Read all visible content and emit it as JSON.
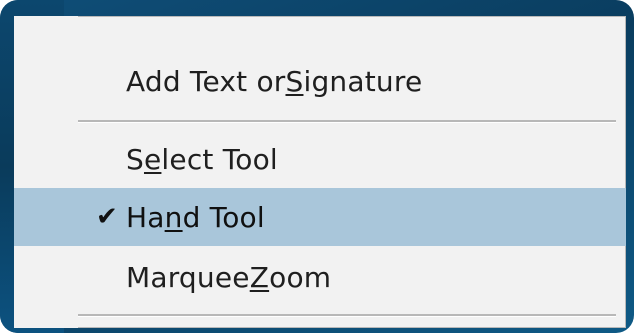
{
  "menu": {
    "items": [
      {
        "pre": "Add Text or ",
        "u": "S",
        "post": "ignature",
        "checked": false,
        "selected": false
      },
      {
        "pre": "S",
        "u": "e",
        "post": "lect Tool",
        "checked": false,
        "selected": false
      },
      {
        "pre": "Ha",
        "u": "n",
        "post": "d Tool",
        "checked": true,
        "selected": true
      },
      {
        "pre": "Marquee ",
        "u": "Z",
        "post": "oom",
        "checked": false,
        "selected": false
      }
    ],
    "checkmark": "✔"
  },
  "colors": {
    "frame": "#0a3d5f",
    "menu_bg": "#f2f2f2",
    "selected_bg": "#a9c6da",
    "separator": "#b8b8b8"
  }
}
